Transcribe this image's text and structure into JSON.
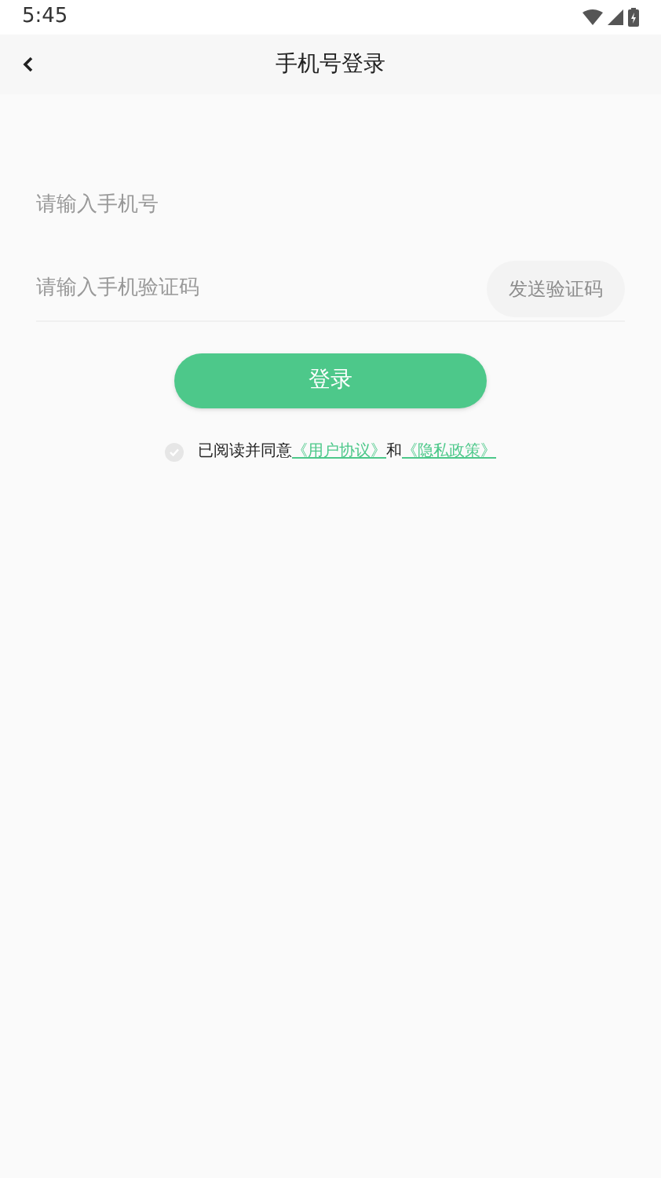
{
  "status_bar": {
    "time": "5:45"
  },
  "app_bar": {
    "title": "手机号登录"
  },
  "phone_field": {
    "placeholder": "请输入手机号"
  },
  "code_field": {
    "placeholder": "请输入手机验证码"
  },
  "send_code_button": {
    "label": "发送验证码",
    "disabled": true
  },
  "login_button": {
    "label": "登录"
  },
  "agreement": {
    "checked": false,
    "text": "已阅读并同意",
    "links": [
      "《用户协议》",
      "《隐私政策》"
    ],
    "joiner": "和"
  }
}
